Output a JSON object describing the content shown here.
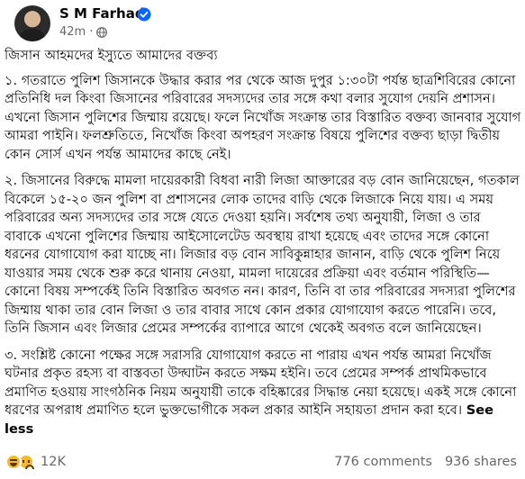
{
  "author": {
    "name": "S M Farhad",
    "verified": true
  },
  "post": {
    "time": "42m",
    "privacy_icon": "globe-icon",
    "title": "জিসান আহমদের ইস্যুতে আমাদের বক্তব্য",
    "paragraphs": [
      "১. গতরাতে পুলিশ জিসানকে উদ্ধার করার পর থেকে আজ দুপুর ১:৩০টা পর্যন্ত ছাত্রশিবিরের কোনো প্রতিনিধি দল কিংবা জিসানের পরিবারের সদস্যদের তার সঙ্গে কথা বলার সুযোগ দেয়নি প্রশাসন। এখনো জিসান পুলিশের জিম্মায় রয়েছে। ফলে নিখোঁজ সংক্রান্ত তার বিস্তারিত বক্তব্য  জানবার সুযোগ আমরা পাইনি। ফলশ্রুতিতে, নিখোঁজ কিংবা অপহরণ সংক্রান্ত বিষয়ে পুলিশের বক্তব্য ছাড়া দ্বিতীয় কোন সোর্স এখন পর্যন্ত আমাদের কাছে নেই।",
      "২. জিসানের বিরুদ্ধে মামলা দায়েরকারী বিধবা নারী লিজা আক্তারের বড় বোন জানিয়েছেন, গতকাল বিকেলে ১৫-২০ জন পুলিশ বা প্রশাসনের লোক তাদের বাড়ি থেকে লিজাকে নিয়ে যায়। এ সময় পরিবারের অন্য সদস্যদের তার সঙ্গে যেতে দেওয়া হয়নি। সর্বশেষ তথ্য অনুযায়ী, লিজা ও তার বাবাকে এখনো পুলিশের জিম্মায়  আইসোলেটেড অবস্থায় রাখা হয়েছে এবং তাদের সঙ্গে কোনো ধরনের যোগাযোগ করা যাচ্ছে না। লিজার বড় বোন সাবিকুন্নাহার জানান, বাড়ি থেকে পুলিশ নিয়ে যাওয়ার সময় থেকে শুরু করে থানায় নেওয়া, মামলা দায়েরের প্রক্রিয়া এবং বর্তমান পরিস্থিতি—কোনো বিষয় সম্পর্কেই তিনি বিস্তারিত অবগত নন। কারণ, তিনি বা তার পরিবারের সদস্যরা পুলিশের জিম্মায় থাকা তার বোন লিজা ও তার বাবার সাথে কোন প্রকার যোগাযোগ করতে পারেনি। তবে,  তিনি জিসান এবং লিজার প্রেমের সম্পর্কের ব্যাপারে আগে থেকেই অবগত বলে জানিয়েছেন।",
      "৩. সংশ্লিষ্ট কোনো পক্ষের সঙ্গে সরাসরি যোগাযোগ করতে না পারায় এখন পর্যন্ত আমরা নিখোঁজ ঘটনার প্রকৃত রহস্য বা বাস্তবতা উদ্ঘাটন করতে সক্ষম হইনি। তবে প্রেমের সম্পর্ক প্রাথমিকভাবে প্রমাণিত হওয়ায় সাংগঠনিক নিয়ম অনুযায়ী তাকে বহিষ্কারের সিদ্ধান্ত নেয়া হয়েছে। একই সঙ্গে কোনো ধরণের অপরাধ প্রমাণিত হলে ভুক্তভোগীকে সকল প্রকার আইনি সহায়তা প্রদান করা হবে।"
    ],
    "see_less": "See less"
  },
  "footer": {
    "reaction_icons": [
      "haha-reaction-icon",
      "sad-reaction-icon"
    ],
    "reaction_count": "12K",
    "comments": "776 comments",
    "shares": "936 shares"
  },
  "colors": {
    "verified_blue": "#0866ff",
    "secondary_text": "#65676b",
    "reaction_yellow": "#f7b928"
  }
}
